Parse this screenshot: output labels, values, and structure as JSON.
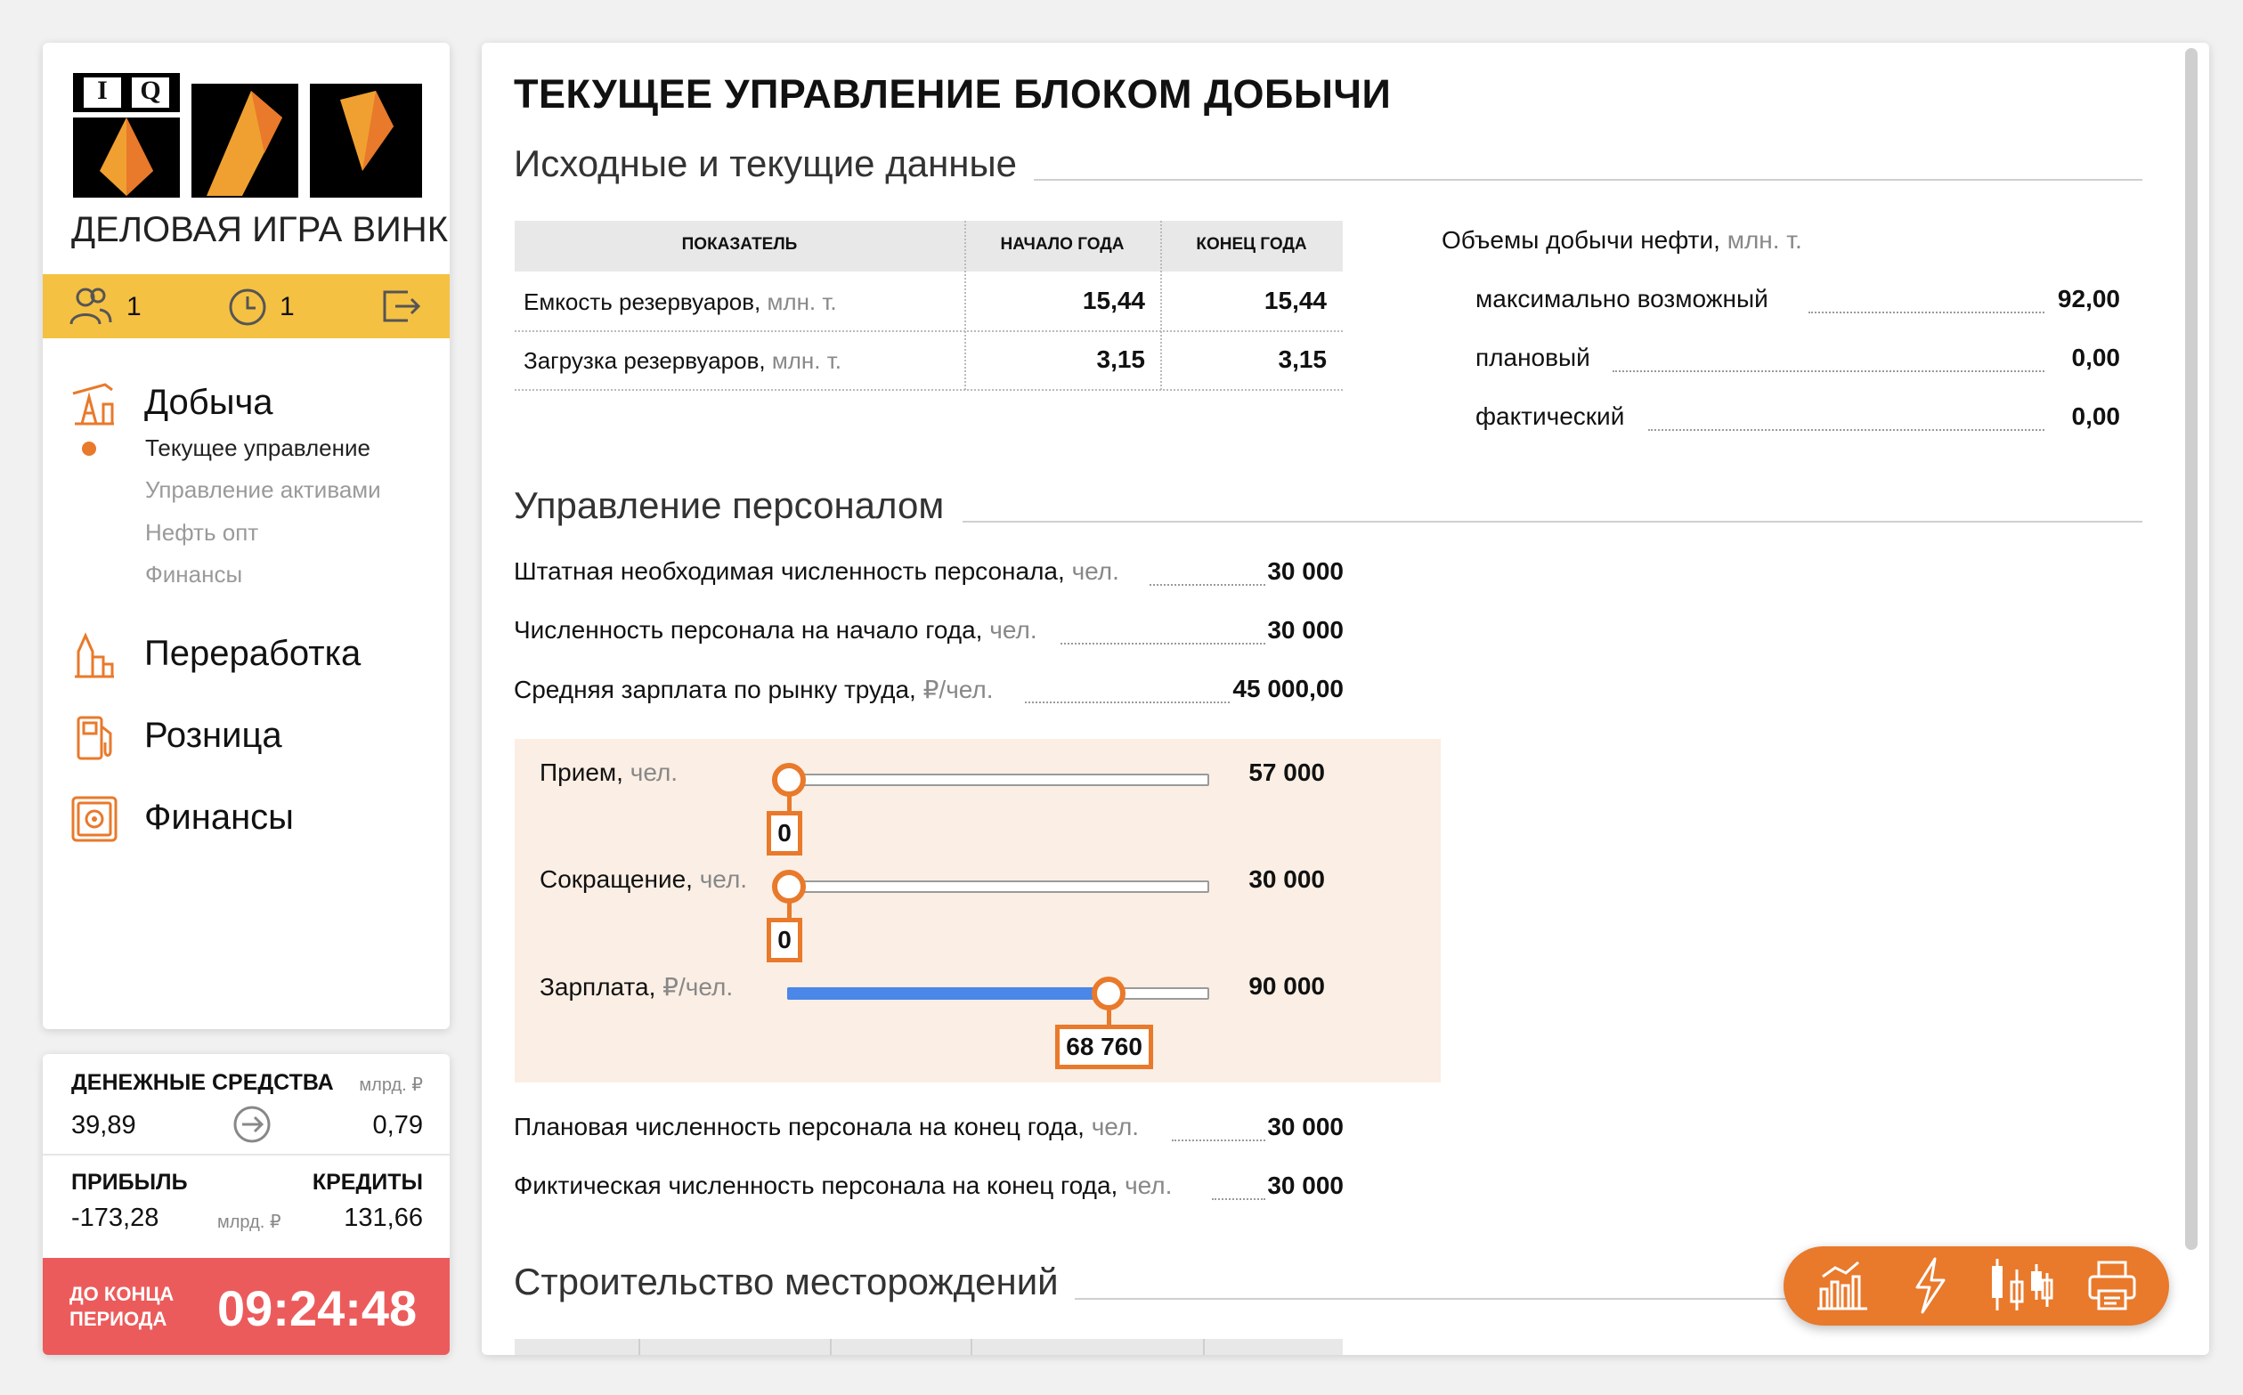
{
  "sidebar": {
    "logo": {
      "letters": [
        "I",
        "Q"
      ],
      "title": "ДЕЛОВАЯ ИГРА ВИНК"
    },
    "stats": {
      "users": "1",
      "clock": "1"
    },
    "nav": {
      "extraction": {
        "label": "Добыча",
        "items": [
          "Текущее управление",
          "Управление активами",
          "Нефть опт",
          "Финансы"
        ]
      },
      "processing": "Переработка",
      "retail": "Розница",
      "finance": "Финансы"
    }
  },
  "finance_card": {
    "cash_label": "ДЕНЕЖНЫЕ СРЕДСТВА",
    "cash_unit": "млрд. ₽",
    "cash_value": "39,89",
    "cash_transfer": "0,79",
    "profit_label": "ПРИБЫЛЬ",
    "credits_label": "КРЕДИТЫ",
    "profit_value": "-173,28",
    "pc_unit": "млрд. ₽",
    "credits_value": "131,66"
  },
  "timer": {
    "label_1": "ДО КОНЦА",
    "label_2": "ПЕРИОДА",
    "value": "09:24:48"
  },
  "main": {
    "title": "ТЕКУЩЕЕ УПРАВЛЕНИЕ БЛОКОМ ДОБЫЧИ",
    "section_data": "Исходные и текущие данные",
    "table": {
      "headers": [
        "ПОКАЗАТЕЛЬ",
        "НАЧАЛО ГОДА",
        "КОНЕЦ ГОДА"
      ],
      "rows": [
        {
          "label": "Емкость резервуаров,",
          "unit": "млн. т.",
          "start": "15,44",
          "end": "15,44"
        },
        {
          "label": "Загрузка резервуаров,",
          "unit": "млн. т.",
          "start": "3,15",
          "end": "3,15"
        }
      ]
    },
    "volumes": {
      "title": "Объемы добычи нефти,",
      "unit": "млн. т.",
      "rows": [
        {
          "label": "максимально возможный",
          "value": "92,00"
        },
        {
          "label": "плановый",
          "value": "0,00"
        },
        {
          "label": "фактический",
          "value": "0,00"
        }
      ]
    },
    "section_staff": "Управление персоналом",
    "staff_rows": [
      {
        "label": "Штатная необходимая численность персонала,",
        "unit": "чел.",
        "value": "30 000"
      },
      {
        "label": "Численность персонала на начало года,",
        "unit": "чел.",
        "value": "30 000"
      },
      {
        "label": "Средняя зарплата по рынку труда,",
        "unit": "₽/чел.",
        "value": "45 000,00"
      }
    ],
    "sliders": [
      {
        "label": "Прием,",
        "unit": "чел.",
        "value": "0",
        "max": "57 000",
        "fraction": 0.0
      },
      {
        "label": "Сокращение,",
        "unit": "чел.",
        "value": "0",
        "max": "30 000",
        "fraction": 0.0
      },
      {
        "label": "Зарплата,",
        "unit": "₽/чел.",
        "value": "68 760",
        "max": "90 000",
        "fraction": 0.764
      }
    ],
    "plan_rows": [
      {
        "label": "Плановая численность персонала на конец года,",
        "unit": "чел.",
        "value": "30 000"
      },
      {
        "label": "Фиктическая численность персонала на конец года,",
        "unit": "чел.",
        "value": "30 000"
      }
    ],
    "section_build": "Строительство месторождений"
  },
  "toolbar": {
    "buttons": [
      "chart-icon",
      "lightning-icon",
      "candlestick-icon",
      "print-icon"
    ]
  },
  "colors": {
    "accent": "#e9792b",
    "yellow": "#f5c142",
    "timer_red": "#ec5b5b",
    "slider_blue": "#4a87e8",
    "slider_bg": "#fbeee4"
  }
}
